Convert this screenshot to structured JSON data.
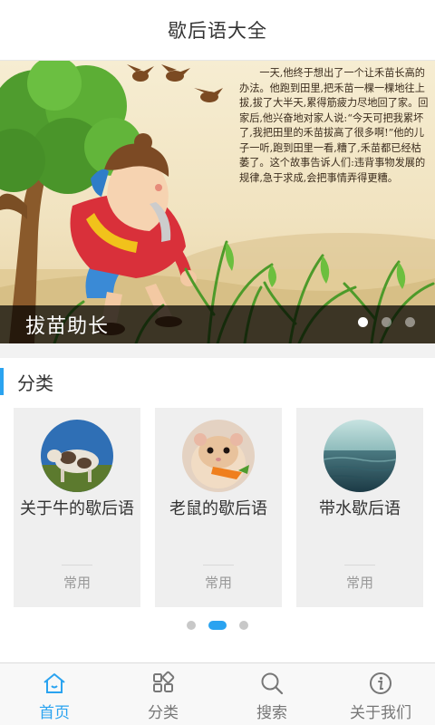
{
  "app": {
    "title": "歇后语大全"
  },
  "banner": {
    "caption": "拔苗助长",
    "story_text": "一天,他终于想出了一个让禾苗长高的办法。他跑到田里,把禾苗一棵一棵地往上拔,拔了大半天,累得筋疲力尽地回了家。回家后,他兴奋地对家人说:“今天可把我累坏了,我把田里的禾苗拔高了很多啊!”他的儿子一听,跑到田里一看,糟了,禾苗都已经枯萎了。这个故事告诉人们:违背事物发展的规律,急于求成,会把事情弄得更糟。",
    "slides": 3,
    "active_slide": 1
  },
  "section": {
    "title": "分类"
  },
  "categories": [
    {
      "name": "关于牛的歇后语",
      "tag": "常用",
      "icon": "cow-photo"
    },
    {
      "name": "老鼠的歇后语",
      "tag": "常用",
      "icon": "hamster-photo"
    },
    {
      "name": "带水歇后语",
      "tag": "常用",
      "icon": "water-photo"
    }
  ],
  "pager": {
    "pages": 3,
    "active": 2
  },
  "tabbar": {
    "items": [
      {
        "label": "首页",
        "icon": "home-icon",
        "active": true
      },
      {
        "label": "分类",
        "icon": "category-grid-icon",
        "active": false
      },
      {
        "label": "搜索",
        "icon": "search-icon",
        "active": false
      },
      {
        "label": "关于我们",
        "icon": "info-icon",
        "active": false
      }
    ]
  },
  "colors": {
    "accent": "#2aa3f0",
    "caption_bg": "#000000",
    "card_bg": "#efefef"
  }
}
